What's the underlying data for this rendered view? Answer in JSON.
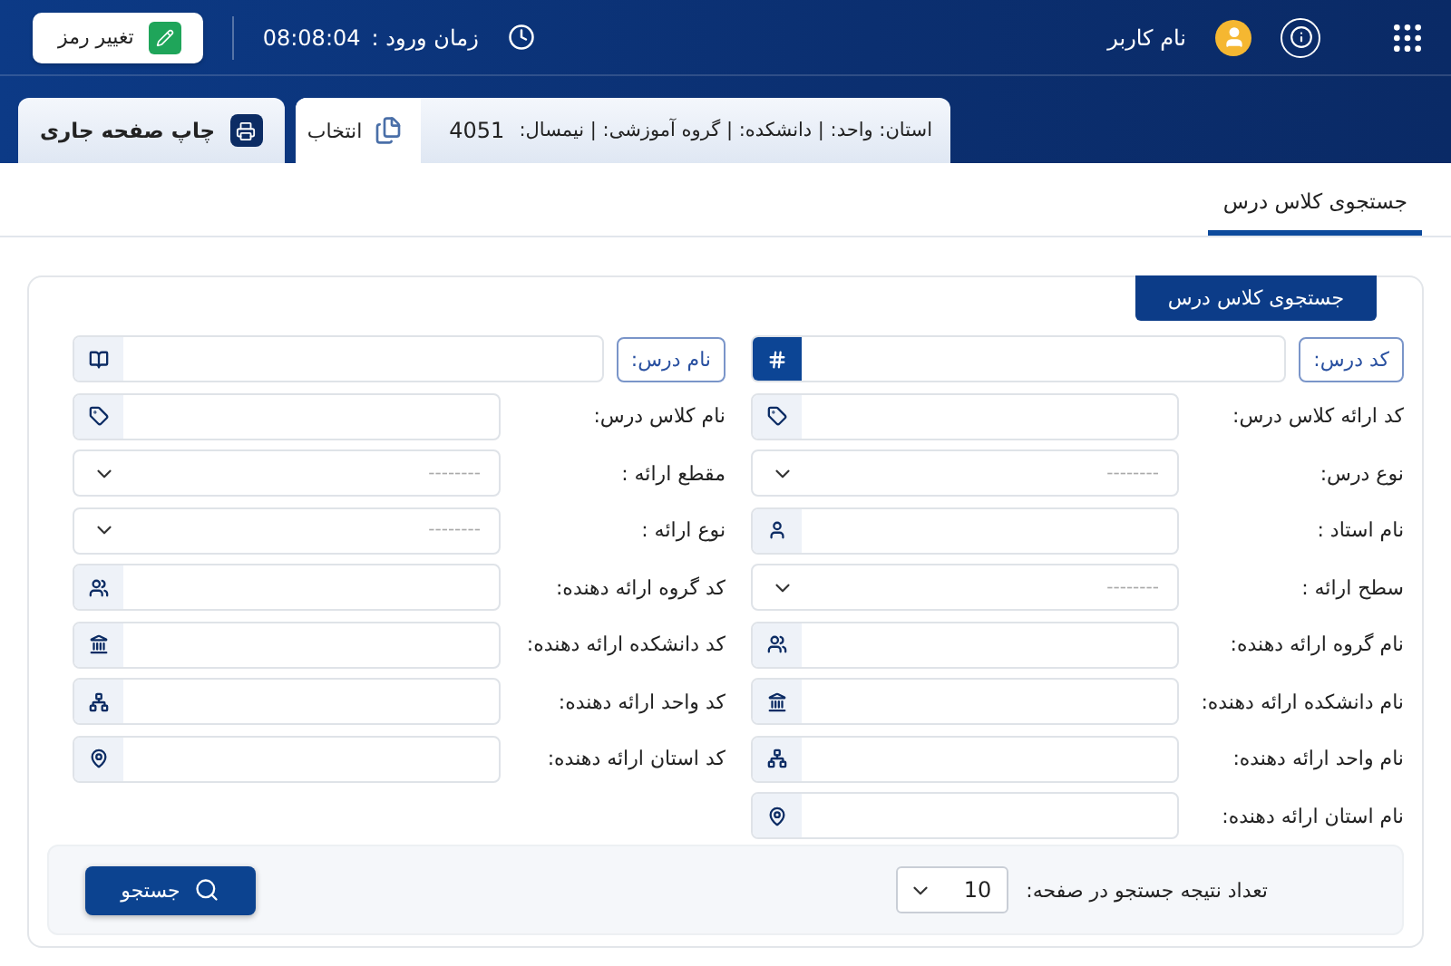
{
  "header": {
    "user_name": "نام کاربر",
    "login_label": "زمان ورود :",
    "login_time": "08:08:04",
    "change_password": "تغییر رمز"
  },
  "context_bar": {
    "info": "استان: واحد: | دانشکده: | گروه آموزشی: | نیمسال:",
    "term": "4051",
    "select_button": "انتخاب",
    "print_button": "چاپ صفحه جاری"
  },
  "tabs": [
    {
      "label": "جستجوی کلاس درس",
      "selected": true
    }
  ],
  "form": {
    "legend": "جستجوی کلاس درس",
    "right_fields": [
      {
        "label": "کد درس:",
        "kind": "key",
        "highlighted": true
      },
      {
        "label": "کد ارائه کلاس درس:",
        "kind": "text"
      },
      {
        "label": "نوع درس:",
        "kind": "select",
        "placeholder": "--------"
      },
      {
        "label": "نام استاد :",
        "kind": "text"
      },
      {
        "label": "سطح ارائه :",
        "kind": "select",
        "placeholder": "--------"
      },
      {
        "label": "نام گروه ارائه دهنده:",
        "kind": "text"
      },
      {
        "label": "نام دانشکده ارائه دهنده:",
        "kind": "text"
      },
      {
        "label": "نام واحد ارائه دهنده:",
        "kind": "text"
      },
      {
        "label": "نام استان ارائه دهنده:",
        "kind": "text"
      }
    ],
    "left_fields": [
      {
        "label": "نام درس:",
        "kind": "key",
        "highlighted": false
      },
      {
        "label": "نام کلاس درس:",
        "kind": "text"
      },
      {
        "label": "مقطع ارائه :",
        "kind": "select",
        "placeholder": "--------"
      },
      {
        "label": "نوع ارائه :",
        "kind": "select",
        "placeholder": "--------"
      },
      {
        "label": "کد گروه ارائه دهنده:",
        "kind": "text"
      },
      {
        "label": "کد دانشکده ارائه دهنده:",
        "kind": "text"
      },
      {
        "label": "کد واحد ارائه دهنده:",
        "kind": "text"
      },
      {
        "label": "کد استان ارائه دهنده:",
        "kind": "text"
      }
    ],
    "page_size_label": "تعداد نتیجه جستجو در صفحه:",
    "page_size": "10",
    "search_button": "جستجو"
  }
}
